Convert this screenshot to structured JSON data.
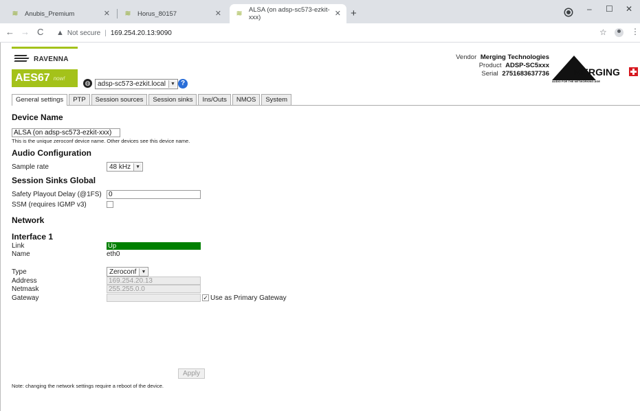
{
  "browser": {
    "tabs": [
      {
        "title": "Anubis_Premium"
      },
      {
        "title": "Horus_80157"
      },
      {
        "title": "ALSA (on adsp-sc573-ezkit-xxx)"
      }
    ],
    "security_label": "Not secure",
    "url": "169.254.20.13:9090"
  },
  "header": {
    "ravenna_text": "RAVENNA",
    "aes_text": "AES67",
    "aes_now": "now!",
    "host_select": "adsp-sc573-ezkit.local",
    "vendor_label": "Vendor",
    "vendor_value": "Merging Technologies",
    "product_label": "Product",
    "product_value": "ADSP-SC5xxx",
    "serial_label": "Serial",
    "serial_value": "2751683637736",
    "merging_logo_text": "MERGING",
    "merging_tagline": "AUDIO FOR THE NETWORKING AGE"
  },
  "page_tabs": [
    {
      "label": "General settings"
    },
    {
      "label": "PTP"
    },
    {
      "label": "Session sources"
    },
    {
      "label": "Session sinks"
    },
    {
      "label": "Ins/Outs"
    },
    {
      "label": "NMOS"
    },
    {
      "label": "System"
    }
  ],
  "device": {
    "heading": "Device Name",
    "name_value": "ALSA (on adsp-sc573-ezkit-xxx)",
    "help_text": "This is the unique zeroconf device name. Other devices see this device name."
  },
  "audio": {
    "heading": "Audio Configuration",
    "sample_rate_label": "Sample rate",
    "sample_rate_value": "48 kHz"
  },
  "sinks": {
    "heading": "Session Sinks Global",
    "delay_label": "Safety Playout Delay (@1FS)",
    "delay_value": "0",
    "ssm_label": "SSM (requires IGMP v3)",
    "ssm_checked": false
  },
  "network": {
    "heading": "Network",
    "interface_heading": "Interface 1",
    "link_label": "Link",
    "link_value": "Up",
    "name_label": "Name",
    "name_value": "eth0",
    "type_label": "Type",
    "type_value": "Zeroconf",
    "address_label": "Address",
    "address_value": "169.254.20.13",
    "netmask_label": "Netmask",
    "netmask_value": "255.255.0.0",
    "gateway_label": "Gateway",
    "gateway_value": "",
    "primary_gateway_label": "Use as Primary Gateway",
    "primary_gateway_checked": true,
    "apply_label": "Apply",
    "note": "Note: changing the network settings require a reboot of the device."
  },
  "colors": {
    "ravenna_green": "#a4c21a",
    "link_up_green": "#008000",
    "help_blue": "#2a6ed8"
  }
}
